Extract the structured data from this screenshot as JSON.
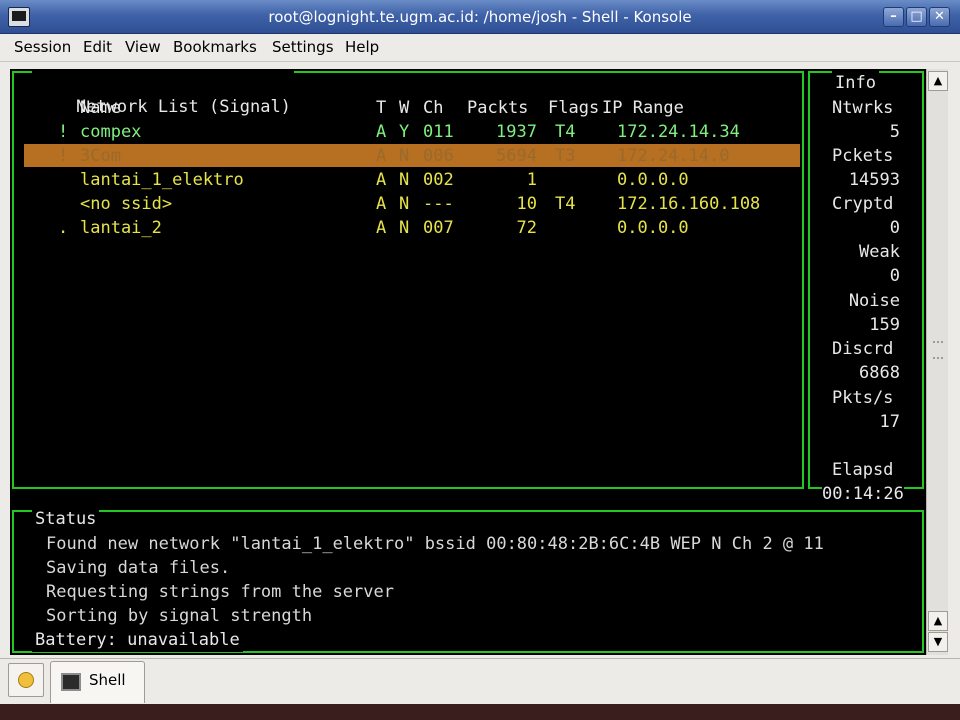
{
  "window": {
    "title": "root@lognight.te.ugm.ac.id: /home/josh - Shell - Konsole",
    "minimize": "–",
    "maximize": "□",
    "close": "✕"
  },
  "menu": [
    "Session",
    "Edit",
    "View",
    "Bookmarks",
    "Settings",
    "Help"
  ],
  "network_list": {
    "title": "Network List",
    "sort": "(Signal)",
    "headers": {
      "name": "Name",
      "t": "T",
      "w": "W",
      "ch": "Ch",
      "packets": "Packts",
      "flags": "Flags",
      "ip": "IP Range"
    },
    "rows": [
      {
        "mark": "!",
        "name": "compex",
        "t": "A",
        "w": "Y",
        "ch": "011",
        "packets": "1937",
        "flags": "T4",
        "ip": "172.24.14.34",
        "style": "lg"
      },
      {
        "mark": "!",
        "name": "3Com",
        "t": "A",
        "w": "N",
        "ch": "006",
        "packets": "5694",
        "flags": "T3",
        "ip": "172.24.14.0",
        "style": "selected"
      },
      {
        "mark": "",
        "name": "lantai_1_elektro",
        "t": "A",
        "w": "N",
        "ch": "002",
        "packets": "1",
        "flags": "",
        "ip": "0.0.0.0",
        "style": "y"
      },
      {
        "mark": "",
        "name": "<no ssid>",
        "t": "A",
        "w": "N",
        "ch": "---",
        "packets": "10",
        "flags": "T4",
        "ip": "172.16.160.108",
        "style": "y"
      },
      {
        "mark": ".",
        "name": "lantai_2",
        "t": "A",
        "w": "N",
        "ch": "007",
        "packets": "72",
        "flags": "",
        "ip": "0.0.0.0",
        "style": "y"
      }
    ]
  },
  "info": {
    "title": "Info",
    "items": [
      {
        "label": "Ntwrks",
        "value": "5"
      },
      {
        "label": "Pckets",
        "value": "14593"
      },
      {
        "label": "Cryptd",
        "value": "0"
      },
      {
        "label": "Weak",
        "value": "0"
      },
      {
        "label": "Noise",
        "value": "159"
      },
      {
        "label": "Discrd",
        "value": "6868"
      },
      {
        "label": "Pkts/s",
        "value": "17"
      }
    ],
    "elapsed_label": "Elapsd",
    "elapsed_value": "00:14:26"
  },
  "status": {
    "title": "Status",
    "lines": [
      "Found new network \"lantai_1_elektro\" bssid 00:80:48:2B:6C:4B WEP N Ch 2 @ 11",
      "Saving data files.",
      "Requesting strings from the server",
      "Sorting by signal strength"
    ],
    "battery": "Battery: unavailable"
  },
  "tabs": [
    {
      "label": "Shell"
    }
  ],
  "colors": {
    "accent": "#22c722",
    "highlight": "#b76f21",
    "text_yellow": "#e6e34a",
    "text_lightgreen": "#7ff07f"
  }
}
